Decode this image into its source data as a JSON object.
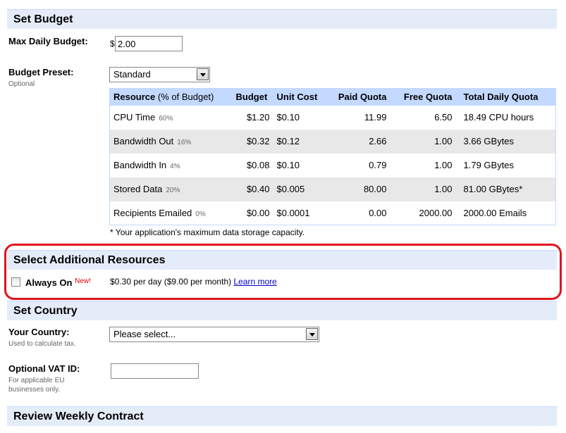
{
  "set_budget": {
    "title": "Set Budget",
    "max_daily_label": "Max Daily Budget:",
    "currency_symbol": "$",
    "max_daily_value": "2.00",
    "preset_label": "Budget Preset:",
    "preset_sublabel": "Optional",
    "preset_value": "Standard"
  },
  "table": {
    "headers": {
      "resource": "Resource",
      "resource_suffix": "(% of Budget)",
      "budget": "Budget",
      "unit_cost": "Unit Cost",
      "paid_quota": "Paid Quota",
      "free_quota": "Free Quota",
      "total_daily_quota": "Total Daily Quota"
    },
    "rows": [
      {
        "resource": "CPU Time",
        "pct": "60%",
        "budget": "$1.20",
        "unit_cost": "$0.10",
        "paid": "11.99",
        "free": "6.50",
        "total": "18.49 CPU hours"
      },
      {
        "resource": "Bandwidth Out",
        "pct": "16%",
        "budget": "$0.32",
        "unit_cost": "$0.12",
        "paid": "2.66",
        "free": "1.00",
        "total": "3.66 GBytes"
      },
      {
        "resource": "Bandwidth In",
        "pct": "4%",
        "budget": "$0.08",
        "unit_cost": "$0.10",
        "paid": "0.79",
        "free": "1.00",
        "total": "1.79 GBytes"
      },
      {
        "resource": "Stored Data",
        "pct": "20%",
        "budget": "$0.40",
        "unit_cost": "$0.005",
        "paid": "80.00",
        "free": "1.00",
        "total": "81.00 GBytes*"
      },
      {
        "resource": "Recipients Emailed",
        "pct": "0%",
        "budget": "$0.00",
        "unit_cost": "$0.0001",
        "paid": "0.00",
        "free": "2000.00",
        "total": "2000.00 Emails"
      }
    ],
    "footnote": "* Your application's maximum data storage capacity."
  },
  "additional": {
    "title": "Select Additional Resources",
    "always_on_label": "Always On",
    "new_badge": "New!",
    "price_text": "$0.30 per day ($9.00 per month)",
    "learn_more": "Learn more",
    "highlight_color": "#e0141c"
  },
  "country": {
    "title": "Set Country",
    "country_label": "Your Country:",
    "country_sublabel": "Used to calculate tax.",
    "country_value": "Please select...",
    "vat_label": "Optional VAT ID:",
    "vat_sublabel_1": "For applicable EU",
    "vat_sublabel_2": "businesses only.",
    "vat_value": ""
  },
  "review": {
    "title": "Review Weekly Contract"
  },
  "colors": {
    "section_header_bg": "#e5ecf9",
    "table_header_bg": "#c3d9ff",
    "alt_row_bg": "#e8e8e8",
    "link": "#0000cc"
  }
}
